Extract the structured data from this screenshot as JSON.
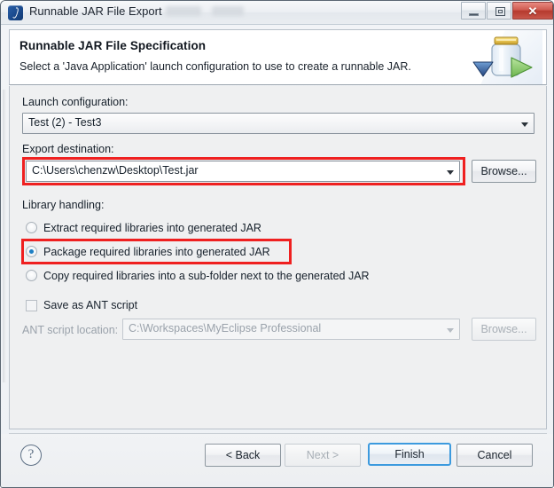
{
  "window": {
    "title": "Runnable JAR File Export",
    "icon": "eclipse-jar-icon",
    "minimize_label": "",
    "maximize_label": "",
    "close_label": "✕"
  },
  "header": {
    "title": "Runnable JAR File Specification",
    "description": "Select a 'Java Application' launch configuration to use to create a runnable JAR.",
    "illustration": "jar-export-icon"
  },
  "form": {
    "launch_configuration": {
      "label": "Launch configuration:",
      "value": "Test (2) - Test3"
    },
    "export_destination": {
      "label": "Export destination:",
      "value": "C:\\Users\\chenzw\\Desktop\\Test.jar",
      "browse_label": "Browse...",
      "highlighted": true
    },
    "library_handling": {
      "label": "Library handling:",
      "options": [
        {
          "label": "Extract required libraries into generated JAR",
          "selected": false,
          "highlighted": false
        },
        {
          "label": "Package required libraries into generated JAR",
          "selected": true,
          "highlighted": true
        },
        {
          "label": "Copy required libraries into a sub-folder next to the generated JAR",
          "selected": false,
          "highlighted": false
        }
      ]
    },
    "ant_script": {
      "checkbox_label": "Save as ANT script",
      "checked": false,
      "location_label": "ANT script location:",
      "location_value": "C:\\Workspaces\\MyEclipse Professional",
      "browse_label": "Browse...",
      "disabled": true
    }
  },
  "footer": {
    "help_glyph": "?",
    "buttons": [
      {
        "label": "< Back",
        "state": "enabled"
      },
      {
        "label": "Next >",
        "state": "disabled"
      },
      {
        "label": "Finish",
        "state": "default"
      },
      {
        "label": "Cancel",
        "state": "enabled"
      }
    ]
  },
  "colors": {
    "annotation_red": "#ef2020",
    "focus_blue": "#3c9ade",
    "radio_blue": "#1d7fc4",
    "close_red": "#b63a2e"
  }
}
